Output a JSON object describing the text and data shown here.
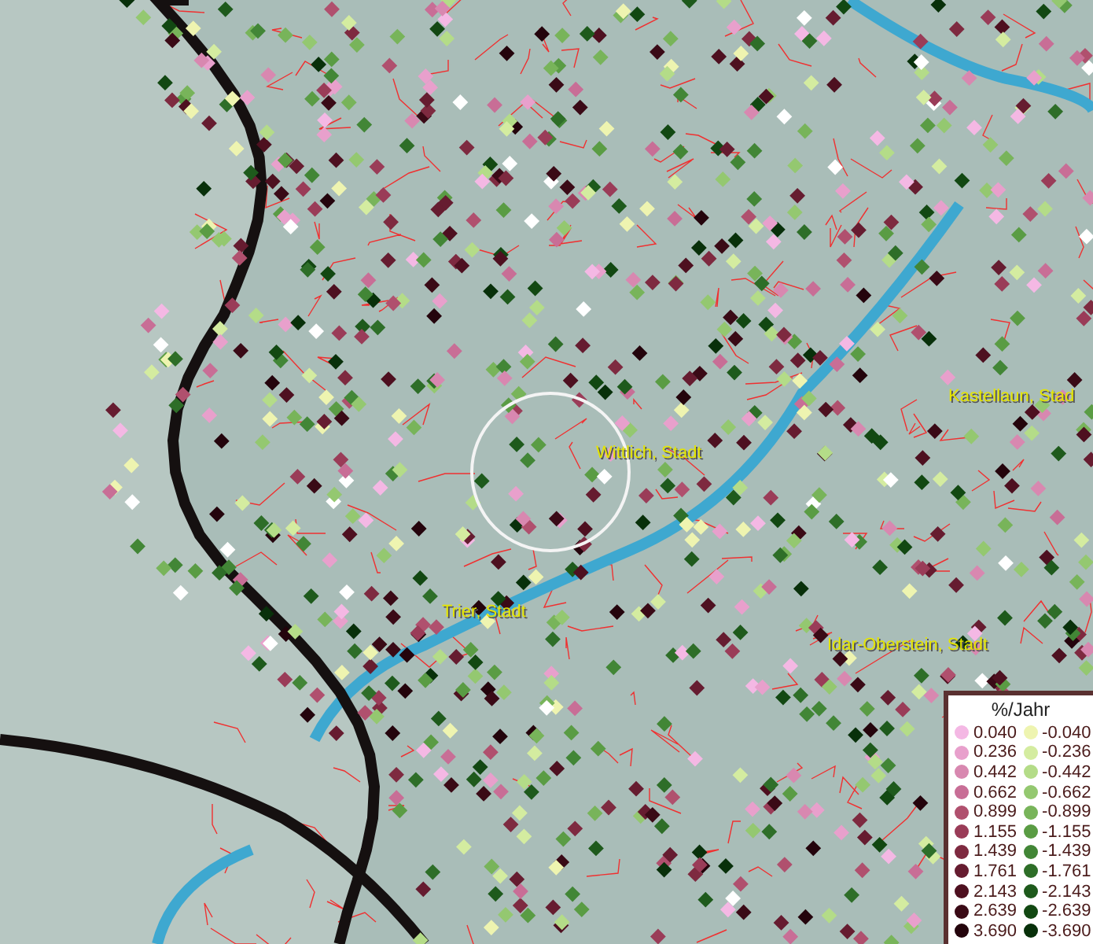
{
  "places": [
    {
      "name": "Wittlich, Stadt"
    },
    {
      "name": "Trier, Stadt"
    },
    {
      "name": "Idar-Oberstein, Stadt"
    },
    {
      "name": "Kastellaun, Stad"
    }
  ],
  "legend": {
    "title": "%/Jahr",
    "rows": [
      {
        "positive": {
          "value": "0.040",
          "color": "#f4b8e4"
        },
        "negative": {
          "value": "-0.040",
          "color": "#eef4b0"
        }
      },
      {
        "positive": {
          "value": "0.236",
          "color": "#e8a0cc"
        },
        "negative": {
          "value": "-0.236",
          "color": "#d4eca0"
        }
      },
      {
        "positive": {
          "value": "0.442",
          "color": "#d888b0"
        },
        "negative": {
          "value": "-0.442",
          "color": "#b4dc88"
        }
      },
      {
        "positive": {
          "value": "0.662",
          "color": "#c86e96"
        },
        "negative": {
          "value": "-0.662",
          "color": "#94c870"
        }
      },
      {
        "positive": {
          "value": "0.899",
          "color": "#b0506e"
        },
        "negative": {
          "value": "-0.899",
          "color": "#78b45a"
        }
      },
      {
        "positive": {
          "value": "1.155",
          "color": "#9a3c58"
        },
        "negative": {
          "value": "-1.155",
          "color": "#5a9c44"
        }
      },
      {
        "positive": {
          "value": "1.439",
          "color": "#7e2a40"
        },
        "negative": {
          "value": "-1.439",
          "color": "#428636"
        }
      },
      {
        "positive": {
          "value": "1.761",
          "color": "#661c30"
        },
        "negative": {
          "value": "-1.761",
          "color": "#2e6e28"
        }
      },
      {
        "positive": {
          "value": "2.143",
          "color": "#4e1020"
        },
        "negative": {
          "value": "-2.143",
          "color": "#1e5a1c"
        }
      },
      {
        "positive": {
          "value": "2.639",
          "color": "#3a0a16"
        },
        "negative": {
          "value": "-2.639",
          "color": "#124812"
        }
      },
      {
        "positive": {
          "value": "3.690",
          "color": "#24040c"
        },
        "negative": {
          "value": "-3.690",
          "color": "#08300a"
        }
      }
    ]
  }
}
